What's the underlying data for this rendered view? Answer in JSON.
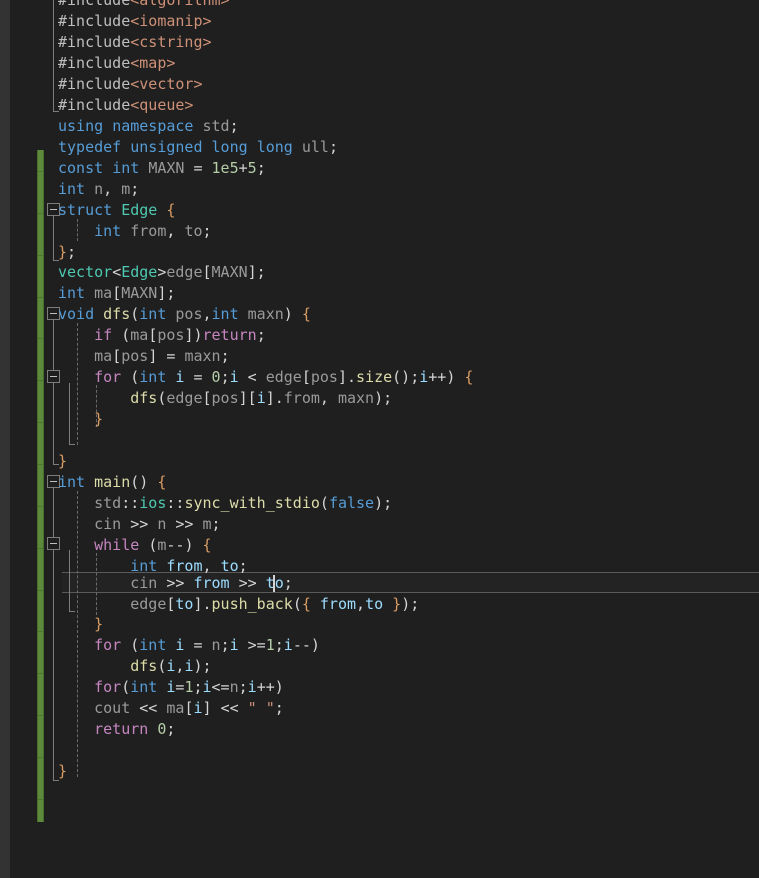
{
  "app": {
    "kind": "code-editor",
    "theme": "dark",
    "language": "C++"
  },
  "colors": {
    "background": "#1f1f1f",
    "left_strip": "#333333",
    "current_line_background": "#232323",
    "current_line_border": "#5a5a5a",
    "change_bar_saved": "#5d8a3a",
    "keyword": "#569cd6",
    "control_keyword": "#c586c0",
    "type": "#4ec9b0",
    "function": "#dcdcaa",
    "identifier": "#9a9a9a",
    "local_variable": "#9cdcfe",
    "number": "#b5cea8",
    "string": "#ce9178",
    "preprocessor": "#bfbfbf",
    "brace": "#da9d63",
    "fold_guide": "#7d7d7d",
    "indent_guide": "#6a6a6a"
  },
  "editor": {
    "caret_line_index": 25,
    "caret_column_text": "cin >> from >> to;",
    "font_size_px": 15,
    "line_height_px": 20.9,
    "first_line_clipped": true
  },
  "code": {
    "lines": [
      {
        "n": 0,
        "text": "#include<algorithm>"
      },
      {
        "n": 1,
        "text": "#include<iomanip>"
      },
      {
        "n": 2,
        "text": "#include<cstring>"
      },
      {
        "n": 3,
        "text": "#include<map>"
      },
      {
        "n": 4,
        "text": "#include<vector>"
      },
      {
        "n": 5,
        "text": "#include<queue>"
      },
      {
        "n": 6,
        "text": "using namespace std;"
      },
      {
        "n": 7,
        "text": "typedef unsigned long long ull;"
      },
      {
        "n": 8,
        "text": "const int MAXN = 1e5+5;"
      },
      {
        "n": 9,
        "text": "int n, m;"
      },
      {
        "n": 10,
        "text": "struct Edge {"
      },
      {
        "n": 11,
        "text": "    int from, to;"
      },
      {
        "n": 12,
        "text": "};"
      },
      {
        "n": 13,
        "text": "vector<Edge>edge[MAXN];"
      },
      {
        "n": 14,
        "text": "int ma[MAXN];"
      },
      {
        "n": 15,
        "text": "void dfs(int pos, int maxn) {"
      },
      {
        "n": 16,
        "text": "    if (ma[pos])return;"
      },
      {
        "n": 17,
        "text": "    ma[pos] = maxn;"
      },
      {
        "n": 18,
        "text": "    for (int i = 0;i < edge[pos].size();i++) {"
      },
      {
        "n": 19,
        "text": "        dfs(edge[pos][i].from, maxn);"
      },
      {
        "n": 20,
        "text": "    }"
      },
      {
        "n": 21,
        "text": ""
      },
      {
        "n": 22,
        "text": "}"
      },
      {
        "n": 23,
        "text": "int main() {"
      },
      {
        "n": 24,
        "text": "    std::ios::sync_with_stdio(false);"
      },
      {
        "n": 25,
        "text": "    cin >> n >> m;"
      },
      {
        "n": 26,
        "text": "    while (m--) {"
      },
      {
        "n": 27,
        "text": "        int from, to;"
      },
      {
        "n": 28,
        "text": "        cin >> from >> to;"
      },
      {
        "n": 29,
        "text": "        edge[to].push_back({ from, to });"
      },
      {
        "n": 30,
        "text": "    }"
      },
      {
        "n": 31,
        "text": "    for (int i = n;i >=1;i--)"
      },
      {
        "n": 32,
        "text": "        dfs(i, i);"
      },
      {
        "n": 33,
        "text": "    for(int i=1;i<=n;i++)"
      },
      {
        "n": 34,
        "text": "    cout << ma[i] << \" \";"
      },
      {
        "n": 35,
        "text": "    return 0;"
      },
      {
        "n": 36,
        "text": ""
      },
      {
        "n": 37,
        "text": ""
      },
      {
        "n": 38,
        "text": "}"
      }
    ]
  },
  "fold_markers": [
    {
      "line": 10,
      "label": "fold-struct-edge"
    },
    {
      "line": 15,
      "label": "fold-dfs-function"
    },
    {
      "line": 18,
      "label": "fold-for-loop"
    },
    {
      "line": 23,
      "label": "fold-main-function"
    },
    {
      "line": 26,
      "label": "fold-while-loop"
    }
  ]
}
